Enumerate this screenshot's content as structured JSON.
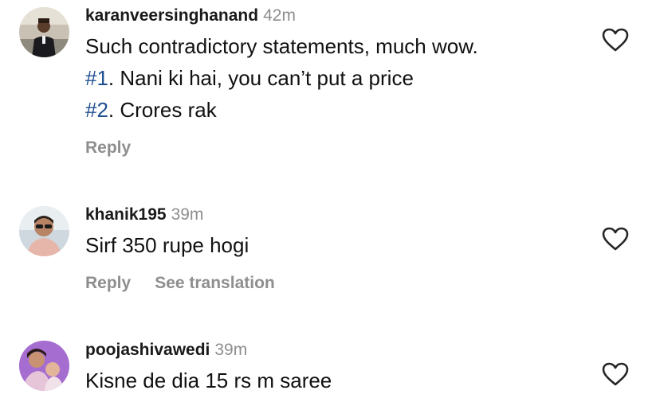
{
  "comments": [
    {
      "username": "karanveersinghanand",
      "time": "42m",
      "text_line1": "Such contradictory statements, much wow.",
      "text_line2_tag": "#1",
      "text_line2_rest": ". Nani ki hai, you can’t put a price",
      "text_line3_tag": "#2",
      "text_line3_rest": ". Crores rak",
      "reply_label": "Reply",
      "avatar_icon": "profile-photo-man-dark-suit",
      "like_icon": "heart-outline-icon"
    },
    {
      "username": "khanik195",
      "time": "39m",
      "text_line1": "Sirf  350 rupe hogi",
      "reply_label": "Reply",
      "translate_label": "See translation",
      "avatar_icon": "profile-photo-man-sunglasses",
      "like_icon": "heart-outline-icon"
    },
    {
      "username": "poojashivawedi",
      "time": "39m",
      "text_line1": "Kisne de dia 15 rs m saree",
      "avatar_icon": "profile-photo-woman-with-child",
      "like_icon": "heart-outline-icon"
    }
  ],
  "colors": {
    "username": "#1a1a1a",
    "secondary_text": "#8e8e8e",
    "hashtag": "#1f4f8f",
    "heart_stroke": "#262626"
  }
}
